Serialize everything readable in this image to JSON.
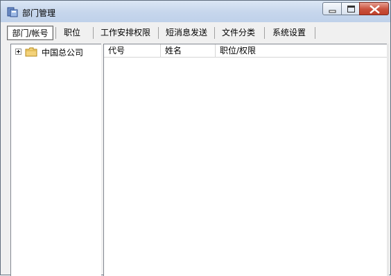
{
  "window": {
    "title": "部门管理",
    "icon": "app-icon",
    "buttons": [
      "minimize-icon",
      "maximize-icon",
      "close-icon"
    ]
  },
  "tabs": [
    {
      "label": "部门/帐号",
      "active": true
    },
    {
      "label": "职位",
      "active": false
    },
    {
      "label": "工作安排权限",
      "active": false
    },
    {
      "label": "短消息发送",
      "active": false
    },
    {
      "label": "文件分类",
      "active": false
    },
    {
      "label": "系统设置",
      "active": false
    }
  ],
  "tree": {
    "nodes": [
      {
        "label": "中国总公司",
        "expander": "plus",
        "icon": "folder-icon"
      }
    ]
  },
  "list": {
    "columns": [
      "代号",
      "姓名",
      "职位/权限"
    ],
    "rows": []
  },
  "colors": {
    "titlebar": "#c6d6ec",
    "close_button": "#c9503c",
    "folder": "#f0c850"
  }
}
